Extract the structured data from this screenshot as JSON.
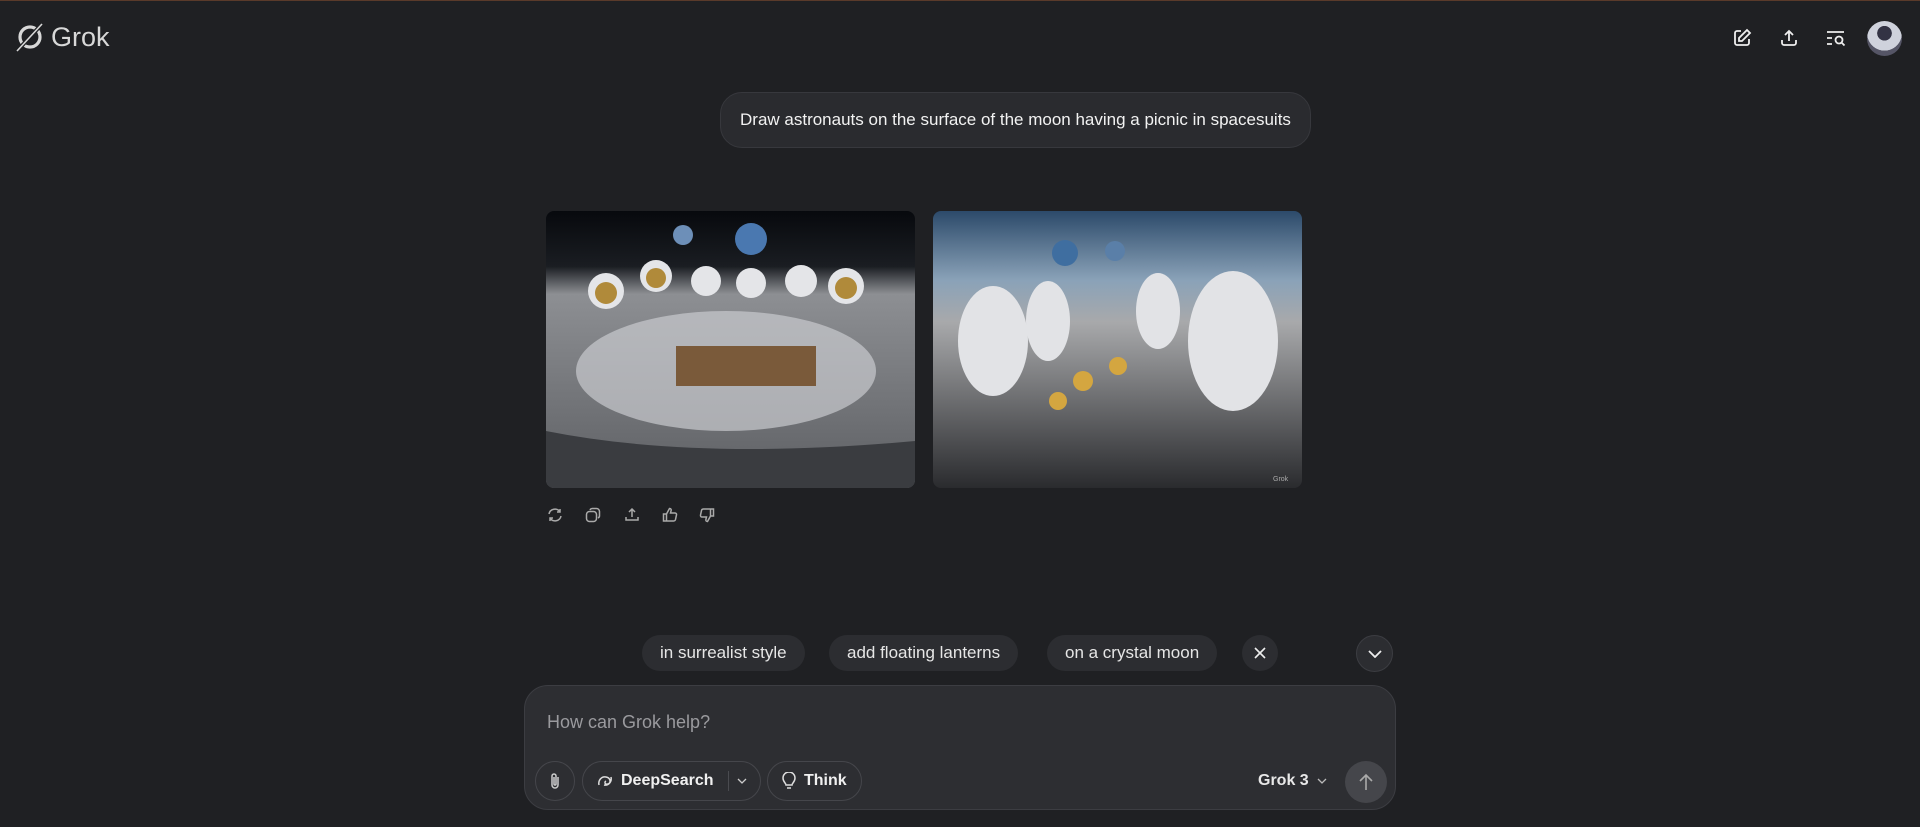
{
  "header": {
    "brand": "Grok",
    "icons": [
      "new-chat-icon",
      "share-icon",
      "history-search-icon",
      "avatar"
    ]
  },
  "conversation": {
    "user_message": "Draw astronauts on the surface of the moon having a picnic in spacesuits",
    "images": [
      {
        "alt": "astronauts picnic at table on moon with earth"
      },
      {
        "alt": "astronauts sitting on moon surface picnic",
        "watermark": "Grok"
      }
    ],
    "actions": [
      "regenerate",
      "copy",
      "share",
      "like",
      "dislike"
    ]
  },
  "suggestions": [
    "in surrealist style",
    "add floating lanterns",
    "on a crystal moon"
  ],
  "composer": {
    "placeholder": "How can Grok help?",
    "deepsearch_label": "DeepSearch",
    "think_label": "Think",
    "model_label": "Grok 3"
  }
}
